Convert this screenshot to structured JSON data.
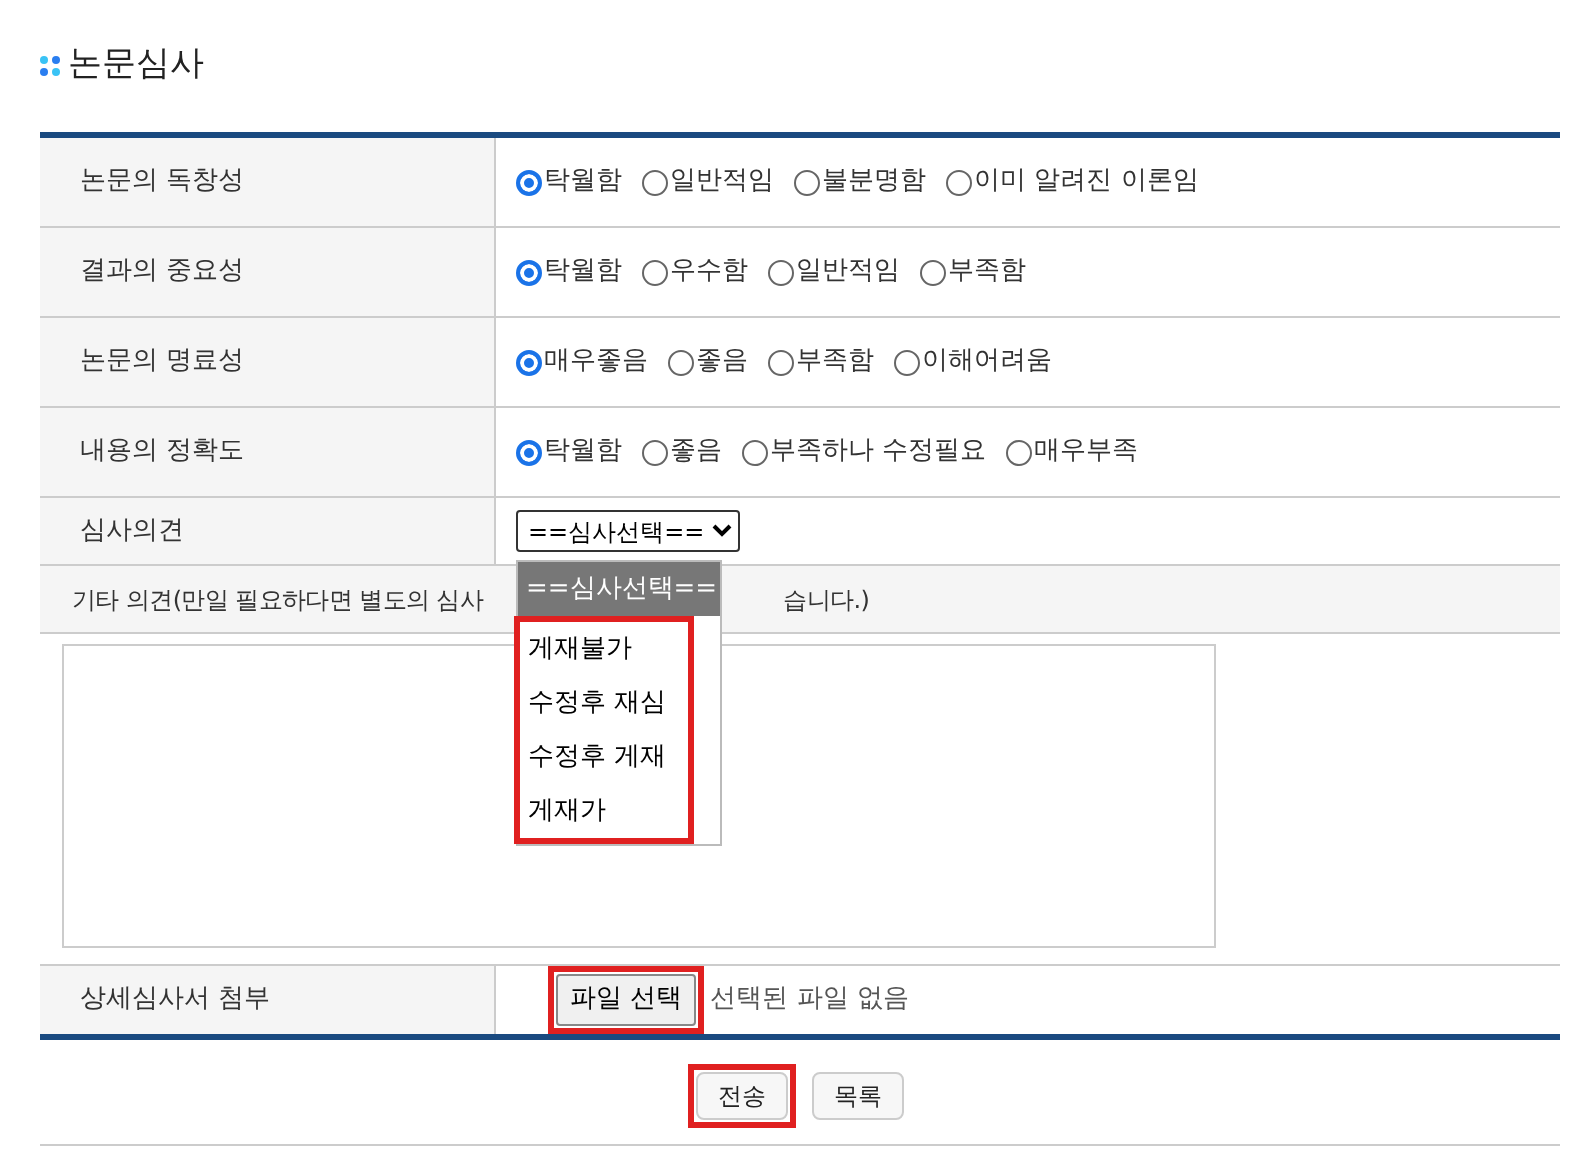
{
  "title": "논문심사",
  "criteria": [
    {
      "label": "논문의 독창성",
      "options": [
        {
          "label": "탁월함",
          "selected": true
        },
        {
          "label": "일반적임",
          "selected": false
        },
        {
          "label": "불분명함",
          "selected": false
        },
        {
          "label": "이미 알려진 이론임",
          "selected": false
        }
      ]
    },
    {
      "label": "결과의 중요성",
      "options": [
        {
          "label": "탁월함",
          "selected": true
        },
        {
          "label": "우수함",
          "selected": false
        },
        {
          "label": "일반적임",
          "selected": false
        },
        {
          "label": "부족함",
          "selected": false
        }
      ]
    },
    {
      "label": "논문의 명료성",
      "options": [
        {
          "label": "매우좋음",
          "selected": true
        },
        {
          "label": "좋음",
          "selected": false
        },
        {
          "label": "부족함",
          "selected": false
        },
        {
          "label": "이해어려움",
          "selected": false
        }
      ]
    },
    {
      "label": "내용의 정확도",
      "options": [
        {
          "label": "탁월함",
          "selected": true
        },
        {
          "label": "좋음",
          "selected": false
        },
        {
          "label": "부족하나 수정필요",
          "selected": false
        },
        {
          "label": "매우부족",
          "selected": false
        }
      ]
    }
  ],
  "opinion": {
    "label": "심사의견",
    "value": "==심사선택==",
    "expanded": true,
    "annotated": true,
    "options": [
      {
        "label": "==심사선택==",
        "selected": true
      },
      {
        "label": "게재불가",
        "selected": false
      },
      {
        "label": "수정후 재심",
        "selected": false
      },
      {
        "label": "수정후 게재",
        "selected": false
      },
      {
        "label": "게재가",
        "selected": false
      }
    ]
  },
  "comment": {
    "label_start": "기타 의견(만일 필요하다면 별도의 심사",
    "label_end": "습니다.)"
  },
  "attachment": {
    "label": "상세심사서 첨부",
    "button": "파일 선택",
    "annotated": true,
    "status": "선택된 파일 없음"
  },
  "buttons": [
    {
      "label": "전송",
      "annotated": true
    },
    {
      "label": "목록",
      "annotated": false
    }
  ]
}
